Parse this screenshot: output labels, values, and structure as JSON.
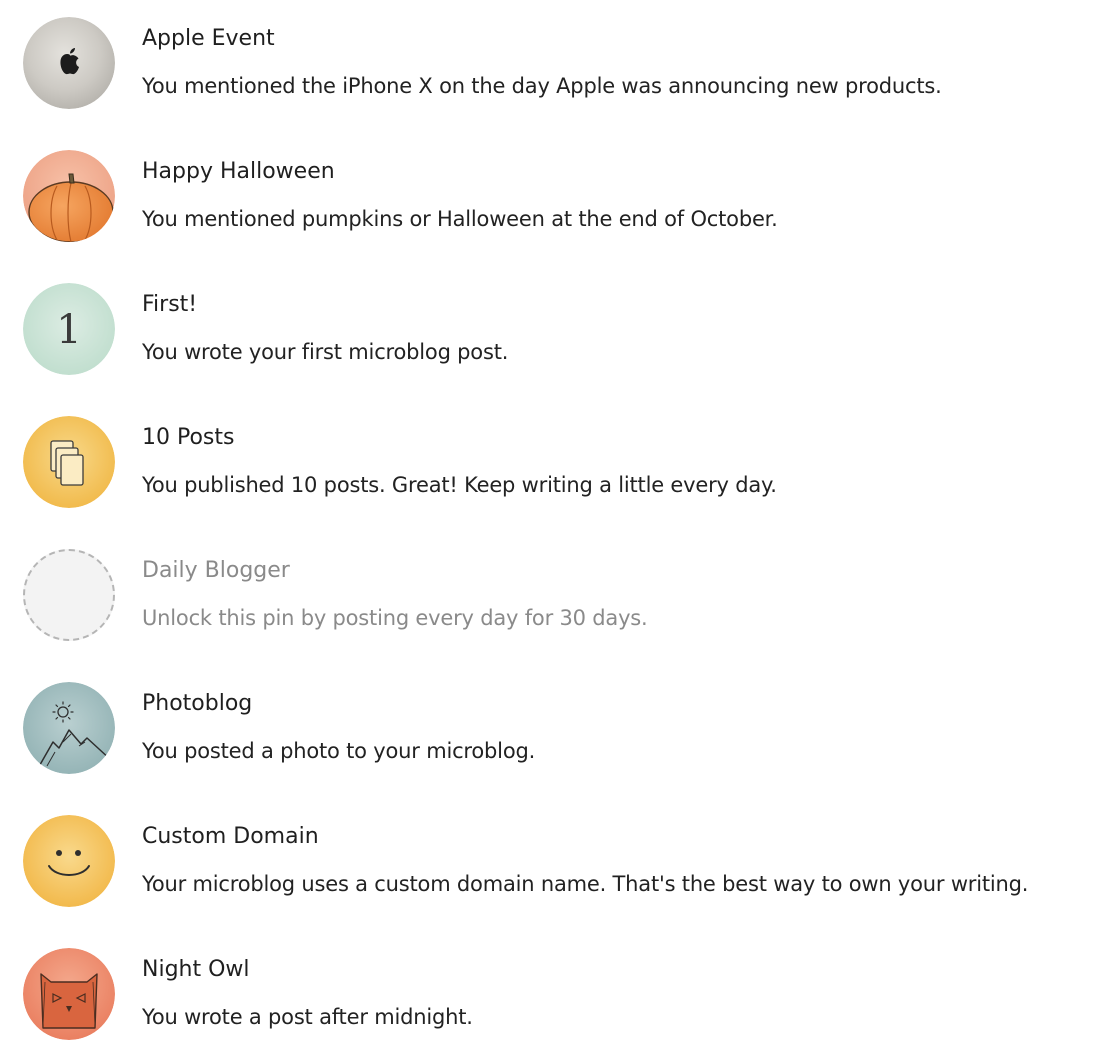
{
  "colors": {
    "title": "#1f1f1f",
    "text": "#222222",
    "locked_text": "#8a8a8a",
    "locked_border": "#b5b5b5"
  },
  "pins": [
    {
      "title": "Apple Event",
      "description": "You mentioned the iPhone X on the day Apple was announcing new products.",
      "icon": "apple-logo-icon",
      "locked": false
    },
    {
      "title": "Happy Halloween",
      "description": "You mentioned pumpkins or Halloween at the end of October.",
      "icon": "pumpkin-icon",
      "locked": false
    },
    {
      "title": "First!",
      "description": "You wrote your first microblog post.",
      "icon": "number-one-icon",
      "badge_text": "1",
      "locked": false
    },
    {
      "title": "10 Posts",
      "description": "You published 10 posts. Great! Keep writing a little every day.",
      "icon": "stacked-pages-icon",
      "locked": false
    },
    {
      "title": "Daily Blogger",
      "description": "Unlock this pin by posting every day for 30 days.",
      "icon": "locked-placeholder-icon",
      "locked": true
    },
    {
      "title": "Photoblog",
      "description": "You posted a photo to your microblog.",
      "icon": "mountain-sun-icon",
      "locked": false
    },
    {
      "title": "Custom Domain",
      "description": "Your microblog uses a custom domain name. That's the best way to own your writing.",
      "icon": "smiley-face-icon",
      "locked": false
    },
    {
      "title": "Night Owl",
      "description": "You wrote a post after midnight.",
      "icon": "owl-icon",
      "locked": false
    }
  ]
}
